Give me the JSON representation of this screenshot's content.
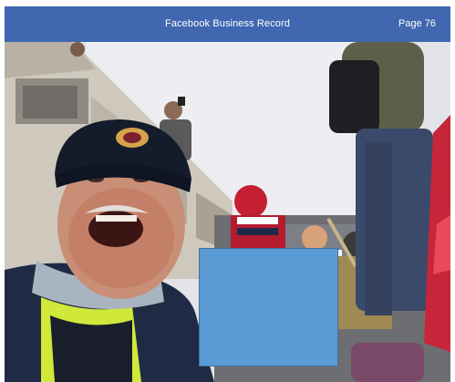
{
  "header": {
    "title": "Facebook Business Record",
    "page_label": "Page 76",
    "background_color": "#4067b0"
  },
  "photo": {
    "description_icon": "crowd-selfie-photo"
  },
  "redaction": {
    "color": "#5b9bd5"
  }
}
